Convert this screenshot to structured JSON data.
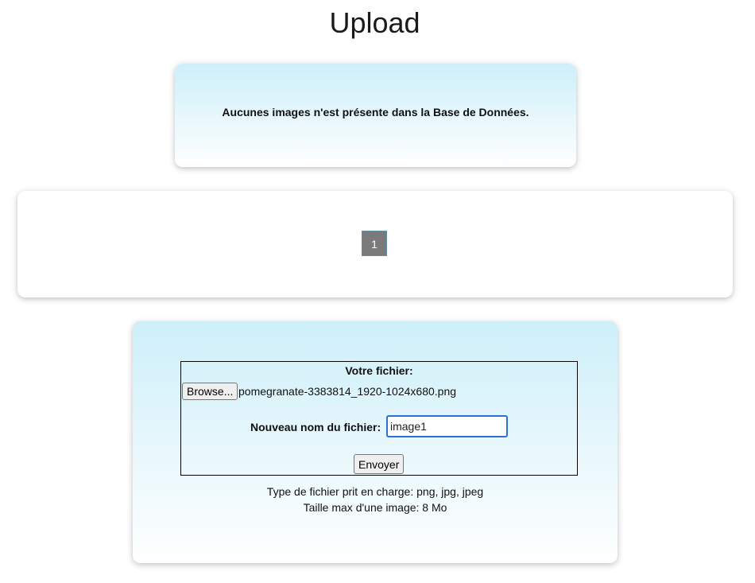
{
  "page": {
    "title": "Upload"
  },
  "info": {
    "message": "Aucunes images n'est présente dans la Base de Données."
  },
  "pagination": {
    "pages": [
      "1"
    ],
    "current": "1"
  },
  "upload_form": {
    "file_label": "Votre fichier:",
    "browse_label": "Browse...",
    "selected_file": "pomegranate-3383814_1920-1024x680.png",
    "rename_label": "Nouveau nom du fichier:",
    "rename_value": "image1",
    "submit_label": "Envoyer",
    "hint_types": "Type de fichier prit en charge: png, jpg, jpeg",
    "hint_size": "Taille max d'une image: 8 Mo"
  },
  "colors": {
    "card_gradient_top": "#cdeff9",
    "card_gradient_bottom": "#ffffff",
    "page_button_bg": "#7a7a7a",
    "input_focus_border": "#2c6fd6"
  }
}
